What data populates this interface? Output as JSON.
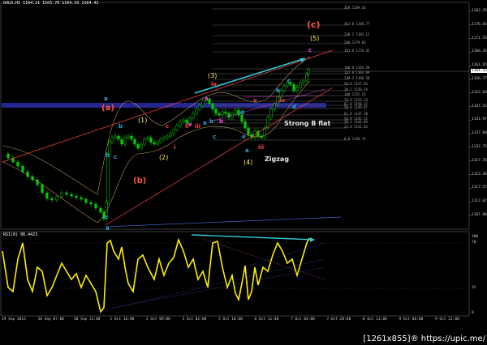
{
  "main_chart": {
    "ohlc_text": "GOLD,H1  1164.21 1165.70 1164.10 1164.42",
    "price_ticks": [
      "1182.35",
      "1176.65",
      "1171.55",
      "1166.45",
      "1161.65",
      "1156.77",
      "1152.04",
      "1147.55",
      "1141.97",
      "1137.84",
      "1132.75",
      "1127.35",
      "1122.46",
      "1117.57",
      "1112.67",
      "1107.88"
    ],
    "current_price": "1164.42",
    "fib_levels": [
      {
        "text": "269.1169.43"
      },
      {
        "text": "361.8 1188.77"
      },
      {
        "text": "236.2 1183.12"
      },
      {
        "text": "200.1179.85"
      },
      {
        "text": "161.8 1176.45"
      },
      {
        "text": "100.0 1164.58"
      },
      {
        "text": "161.8 1163.99"
      },
      {
        "text": "138.2 1160.20"
      },
      {
        "text": "50.0 1157.92"
      },
      {
        "text": "38.2 1156.34"
      },
      {
        "text": "100.1155.13"
      },
      {
        "text": "76.4 1153.13"
      },
      {
        "text": "61.8 1150.37"
      },
      {
        "text": "50.0 1149.87"
      },
      {
        "text": "61.8 1147.18"
      },
      {
        "text": "50.0 1145.11"
      },
      {
        "text": "38.2 1144.04"
      },
      {
        "text": "23.6 1141.62"
      },
      {
        "text": "0.0 1138.74"
      }
    ],
    "wave_labels": {
      "a_red": "(a)",
      "b_red": "(b)",
      "c_red": "(c)",
      "w1": "(1)",
      "w2": "(2)",
      "w3": "(3)",
      "w4": "(4)",
      "w5": "(5)",
      "strong_b_flat": "Strong B flat",
      "zigzag": "Zigzag"
    },
    "small_labels": [
      "a",
      "b",
      "c",
      "a",
      "b",
      "c",
      "d",
      "e",
      "a",
      "b",
      "c",
      "d",
      "e",
      "a",
      "b",
      "c",
      "i",
      "ii",
      "iii",
      "iv",
      "v",
      "iii",
      "iv",
      "v",
      "a",
      "b",
      "c"
    ]
  },
  "rsi_panel": {
    "label": "RSI(8) 86.4423",
    "ticks": [
      "100",
      "70",
      "32",
      "0"
    ]
  },
  "time_axis": {
    "labels": [
      "29 Sep 2015",
      "30 Sep 07:00",
      "30 Sep 23:00",
      "1 Oct 16:00",
      "2 Oct 09:00",
      "5 Oct 02:00",
      "5 Oct 18:00",
      "6 Oct 11:00",
      "7 Oct 04:00",
      "7 Oct 20:00",
      "8 Oct 13:00",
      "9 Oct 06:00",
      "9 Oct 22:00"
    ]
  },
  "watermark": "[1261x855]® https://upic.me/",
  "colors": {
    "background": "#000000",
    "candle_up": "#00cc00",
    "rsi_line": "#ffee00",
    "horizontal_zone": "#2a2aa0",
    "trend_arrow": "#33ccdd",
    "channel_line": "#ff4444"
  }
}
